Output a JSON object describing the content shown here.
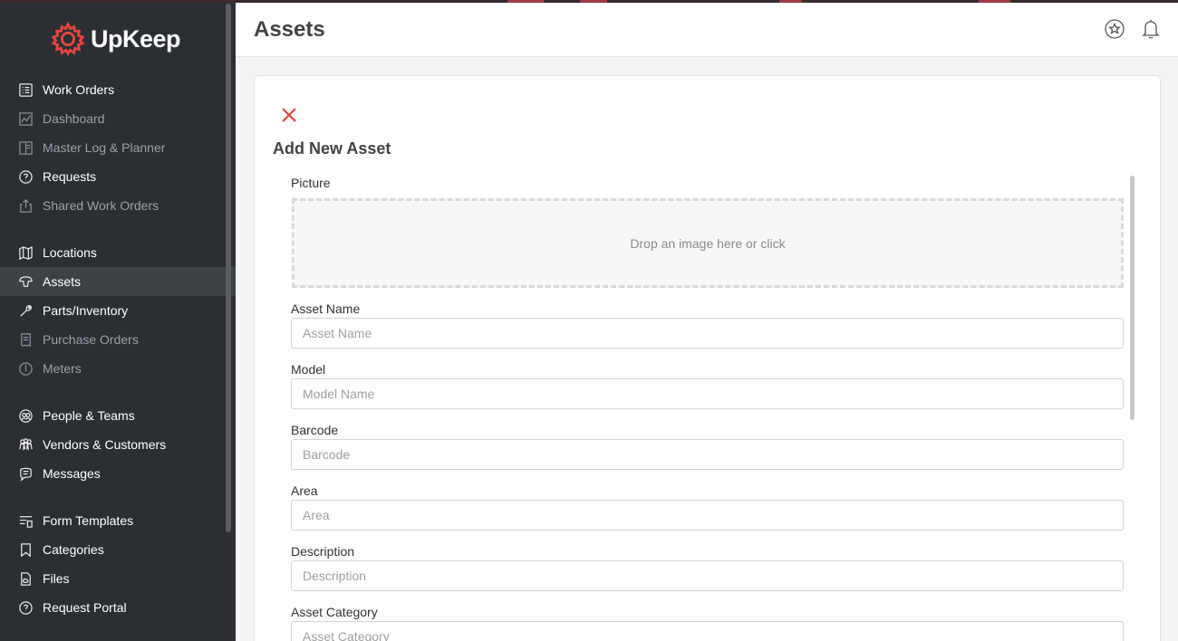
{
  "app": {
    "name": "UpKeep"
  },
  "sidebar": {
    "items": [
      {
        "label": "Work Orders",
        "icon": "list-icon",
        "dim": false
      },
      {
        "label": "Dashboard",
        "icon": "chart-icon",
        "dim": true
      },
      {
        "label": "Master Log & Planner",
        "icon": "planner-icon",
        "dim": true
      },
      {
        "label": "Requests",
        "icon": "question-icon",
        "dim": false
      },
      {
        "label": "Shared Work Orders",
        "icon": "share-icon",
        "dim": true
      },
      {
        "label": "Locations",
        "icon": "map-icon",
        "dim": false
      },
      {
        "label": "Assets",
        "icon": "asset-icon",
        "dim": false,
        "active": true
      },
      {
        "label": "Parts/Inventory",
        "icon": "wrench-icon",
        "dim": false
      },
      {
        "label": "Purchase Orders",
        "icon": "receipt-icon",
        "dim": true
      },
      {
        "label": "Meters",
        "icon": "meter-icon",
        "dim": true
      },
      {
        "label": "People & Teams",
        "icon": "people-icon",
        "dim": false
      },
      {
        "label": "Vendors & Customers",
        "icon": "vendors-icon",
        "dim": false
      },
      {
        "label": "Messages",
        "icon": "chat-icon",
        "dim": false
      },
      {
        "label": "Form Templates",
        "icon": "form-icon",
        "dim": false
      },
      {
        "label": "Categories",
        "icon": "bookmark-icon",
        "dim": false
      },
      {
        "label": "Files",
        "icon": "file-icon",
        "dim": false
      },
      {
        "label": "Request Portal",
        "icon": "question-icon",
        "dim": false
      }
    ]
  },
  "header": {
    "title": "Assets"
  },
  "form": {
    "title": "Add New Asset",
    "picture": {
      "label": "Picture",
      "hint": "Drop an image here or click"
    },
    "asset_name": {
      "label": "Asset Name",
      "placeholder": "Asset Name"
    },
    "model": {
      "label": "Model",
      "placeholder": "Model Name"
    },
    "barcode": {
      "label": "Barcode",
      "placeholder": "Barcode"
    },
    "area": {
      "label": "Area",
      "placeholder": "Area"
    },
    "description": {
      "label": "Description",
      "placeholder": "Description"
    },
    "asset_category": {
      "label": "Asset Category",
      "placeholder": "Asset Category"
    }
  },
  "colors": {
    "brand": "#e5453e",
    "sidebar": "#2b2f33",
    "active": "#3d4247"
  }
}
